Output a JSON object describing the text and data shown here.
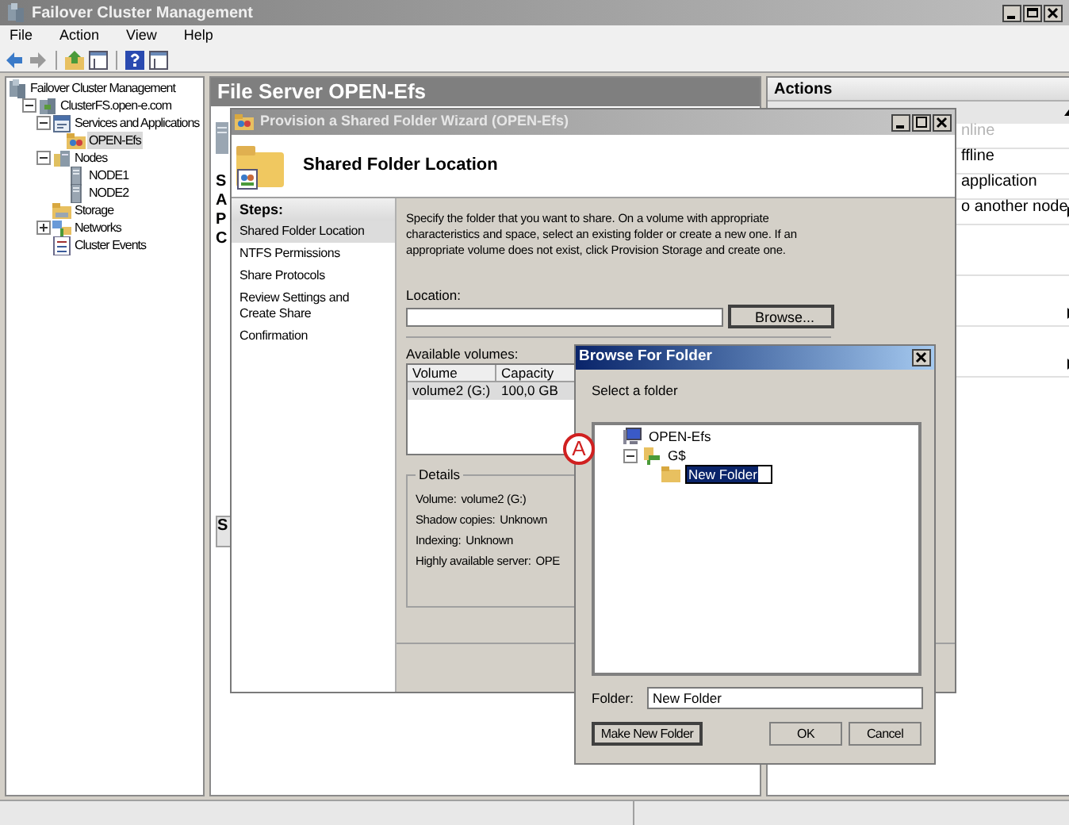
{
  "window": {
    "title": "Failover Cluster Management"
  },
  "menu": [
    "File",
    "Action",
    "View",
    "Help"
  ],
  "toolbar": [
    {
      "kind": "back"
    },
    {
      "kind": "forward"
    },
    {
      "kind": "up"
    },
    {
      "kind": "panel"
    },
    {
      "kind": "help"
    },
    {
      "kind": "panel"
    }
  ],
  "tree": [
    {
      "label": "Failover Cluster Management",
      "kind": "manager",
      "selected": false,
      "children": [
        {
          "label": "ClusterFS.open-e.com",
          "kind": "cluster",
          "expanded": true,
          "selected": false,
          "children": [
            {
              "label": "Services and Applications",
              "kind": "services",
              "expanded": true,
              "selected": false,
              "children": [
                {
                  "label": "OPEN-Efs",
                  "kind": "service",
                  "selected": true
                }
              ]
            },
            {
              "label": "Nodes",
              "kind": "nodes",
              "expanded": true,
              "selected": false,
              "children": [
                {
                  "label": "NODE1",
                  "kind": "node",
                  "selected": false
                },
                {
                  "label": "NODE2",
                  "kind": "node",
                  "selected": false
                }
              ]
            },
            {
              "label": "Storage",
              "kind": "storage",
              "selected": false
            },
            {
              "label": "Networks",
              "kind": "networks",
              "expanded": false,
              "selected": false
            },
            {
              "label": "Cluster Events",
              "kind": "events",
              "selected": false
            }
          ]
        }
      ]
    }
  ],
  "center_pane": {
    "title": "File Server OPEN-Efs",
    "partial_labels": [
      "S",
      "A",
      "P",
      "C"
    ],
    "lower_label": "S"
  },
  "actions": {
    "title": "Actions",
    "items": [
      {
        "label": "nline",
        "disabled": true,
        "submenu": false
      },
      {
        "label": "ffline",
        "disabled": false,
        "submenu": false
      },
      {
        "label": "application",
        "disabled": false,
        "submenu": false
      },
      {
        "label": "o another node",
        "disabled": false,
        "submenu": true
      },
      {
        "submenu": true
      },
      {
        "submenu": true
      }
    ]
  },
  "wizard": {
    "title": "Provision a Shared Folder Wizard (OPEN-Efs)",
    "heading": "Shared Folder Location",
    "steps_title": "Steps:",
    "steps": [
      {
        "label": "Shared Folder Location",
        "selected": true
      },
      {
        "label": "NTFS Permissions",
        "selected": false
      },
      {
        "label": "Share Protocols",
        "selected": false
      },
      {
        "label": "Review Settings and Create Share",
        "selected": false
      },
      {
        "label": "Confirmation",
        "selected": false
      }
    ],
    "description": "Specify the folder that you want to share. On a volume with appropriate characteristics and space, select an existing folder or create a new one. If an appropriate volume does not exist, click Provision Storage and create one.",
    "location_label": "Location:",
    "browse_button": "Browse...",
    "volumes_label": "Available volumes:",
    "volumes_columns": [
      "Volume",
      "Capacity"
    ],
    "volumes_rows": [
      {
        "cells": [
          "volume2 (G:)",
          "100,0 GB"
        ],
        "selected": true
      }
    ],
    "details_title": "Details",
    "details": [
      {
        "label": "Volume:",
        "value": "volume2 (G:)"
      },
      {
        "label": "Shadow copies:",
        "value": "Unknown"
      },
      {
        "label": "Indexing:",
        "value": "Unknown"
      },
      {
        "label": "Highly available server:",
        "value": "OPE"
      }
    ]
  },
  "browse_dialog": {
    "title": "Browse For Folder",
    "prompt": "Select a folder",
    "tree": [
      {
        "label": "OPEN-Efs",
        "kind": "computer",
        "selected": false,
        "children": [
          {
            "label": "G$",
            "kind": "share",
            "expanded": true,
            "selected": false,
            "children": [
              {
                "label": "New Folder",
                "kind": "folder",
                "selected": true,
                "editing": true
              }
            ]
          }
        ]
      }
    ],
    "folder_label": "Folder:",
    "folder_value": "New Folder",
    "buttons": [
      {
        "label": "Make New Folder",
        "default": true
      },
      {
        "label": "OK",
        "default": false
      },
      {
        "label": "Cancel",
        "default": false
      }
    ]
  },
  "callout": {
    "label": "A"
  }
}
